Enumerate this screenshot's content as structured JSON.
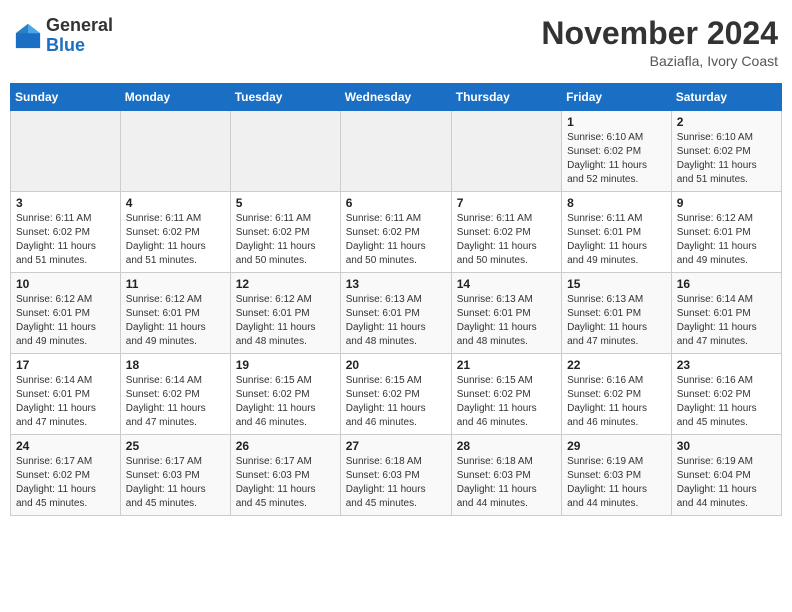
{
  "header": {
    "logo_general": "General",
    "logo_blue": "Blue",
    "month_title": "November 2024",
    "location": "Baziafla, Ivory Coast"
  },
  "days_of_week": [
    "Sunday",
    "Monday",
    "Tuesday",
    "Wednesday",
    "Thursday",
    "Friday",
    "Saturday"
  ],
  "weeks": [
    [
      {
        "day": "",
        "info": ""
      },
      {
        "day": "",
        "info": ""
      },
      {
        "day": "",
        "info": ""
      },
      {
        "day": "",
        "info": ""
      },
      {
        "day": "",
        "info": ""
      },
      {
        "day": "1",
        "info": "Sunrise: 6:10 AM\nSunset: 6:02 PM\nDaylight: 11 hours\nand 52 minutes."
      },
      {
        "day": "2",
        "info": "Sunrise: 6:10 AM\nSunset: 6:02 PM\nDaylight: 11 hours\nand 51 minutes."
      }
    ],
    [
      {
        "day": "3",
        "info": "Sunrise: 6:11 AM\nSunset: 6:02 PM\nDaylight: 11 hours\nand 51 minutes."
      },
      {
        "day": "4",
        "info": "Sunrise: 6:11 AM\nSunset: 6:02 PM\nDaylight: 11 hours\nand 51 minutes."
      },
      {
        "day": "5",
        "info": "Sunrise: 6:11 AM\nSunset: 6:02 PM\nDaylight: 11 hours\nand 50 minutes."
      },
      {
        "day": "6",
        "info": "Sunrise: 6:11 AM\nSunset: 6:02 PM\nDaylight: 11 hours\nand 50 minutes."
      },
      {
        "day": "7",
        "info": "Sunrise: 6:11 AM\nSunset: 6:02 PM\nDaylight: 11 hours\nand 50 minutes."
      },
      {
        "day": "8",
        "info": "Sunrise: 6:11 AM\nSunset: 6:01 PM\nDaylight: 11 hours\nand 49 minutes."
      },
      {
        "day": "9",
        "info": "Sunrise: 6:12 AM\nSunset: 6:01 PM\nDaylight: 11 hours\nand 49 minutes."
      }
    ],
    [
      {
        "day": "10",
        "info": "Sunrise: 6:12 AM\nSunset: 6:01 PM\nDaylight: 11 hours\nand 49 minutes."
      },
      {
        "day": "11",
        "info": "Sunrise: 6:12 AM\nSunset: 6:01 PM\nDaylight: 11 hours\nand 49 minutes."
      },
      {
        "day": "12",
        "info": "Sunrise: 6:12 AM\nSunset: 6:01 PM\nDaylight: 11 hours\nand 48 minutes."
      },
      {
        "day": "13",
        "info": "Sunrise: 6:13 AM\nSunset: 6:01 PM\nDaylight: 11 hours\nand 48 minutes."
      },
      {
        "day": "14",
        "info": "Sunrise: 6:13 AM\nSunset: 6:01 PM\nDaylight: 11 hours\nand 48 minutes."
      },
      {
        "day": "15",
        "info": "Sunrise: 6:13 AM\nSunset: 6:01 PM\nDaylight: 11 hours\nand 47 minutes."
      },
      {
        "day": "16",
        "info": "Sunrise: 6:14 AM\nSunset: 6:01 PM\nDaylight: 11 hours\nand 47 minutes."
      }
    ],
    [
      {
        "day": "17",
        "info": "Sunrise: 6:14 AM\nSunset: 6:01 PM\nDaylight: 11 hours\nand 47 minutes."
      },
      {
        "day": "18",
        "info": "Sunrise: 6:14 AM\nSunset: 6:02 PM\nDaylight: 11 hours\nand 47 minutes."
      },
      {
        "day": "19",
        "info": "Sunrise: 6:15 AM\nSunset: 6:02 PM\nDaylight: 11 hours\nand 46 minutes."
      },
      {
        "day": "20",
        "info": "Sunrise: 6:15 AM\nSunset: 6:02 PM\nDaylight: 11 hours\nand 46 minutes."
      },
      {
        "day": "21",
        "info": "Sunrise: 6:15 AM\nSunset: 6:02 PM\nDaylight: 11 hours\nand 46 minutes."
      },
      {
        "day": "22",
        "info": "Sunrise: 6:16 AM\nSunset: 6:02 PM\nDaylight: 11 hours\nand 46 minutes."
      },
      {
        "day": "23",
        "info": "Sunrise: 6:16 AM\nSunset: 6:02 PM\nDaylight: 11 hours\nand 45 minutes."
      }
    ],
    [
      {
        "day": "24",
        "info": "Sunrise: 6:17 AM\nSunset: 6:02 PM\nDaylight: 11 hours\nand 45 minutes."
      },
      {
        "day": "25",
        "info": "Sunrise: 6:17 AM\nSunset: 6:03 PM\nDaylight: 11 hours\nand 45 minutes."
      },
      {
        "day": "26",
        "info": "Sunrise: 6:17 AM\nSunset: 6:03 PM\nDaylight: 11 hours\nand 45 minutes."
      },
      {
        "day": "27",
        "info": "Sunrise: 6:18 AM\nSunset: 6:03 PM\nDaylight: 11 hours\nand 45 minutes."
      },
      {
        "day": "28",
        "info": "Sunrise: 6:18 AM\nSunset: 6:03 PM\nDaylight: 11 hours\nand 44 minutes."
      },
      {
        "day": "29",
        "info": "Sunrise: 6:19 AM\nSunset: 6:03 PM\nDaylight: 11 hours\nand 44 minutes."
      },
      {
        "day": "30",
        "info": "Sunrise: 6:19 AM\nSunset: 6:04 PM\nDaylight: 11 hours\nand 44 minutes."
      }
    ]
  ]
}
